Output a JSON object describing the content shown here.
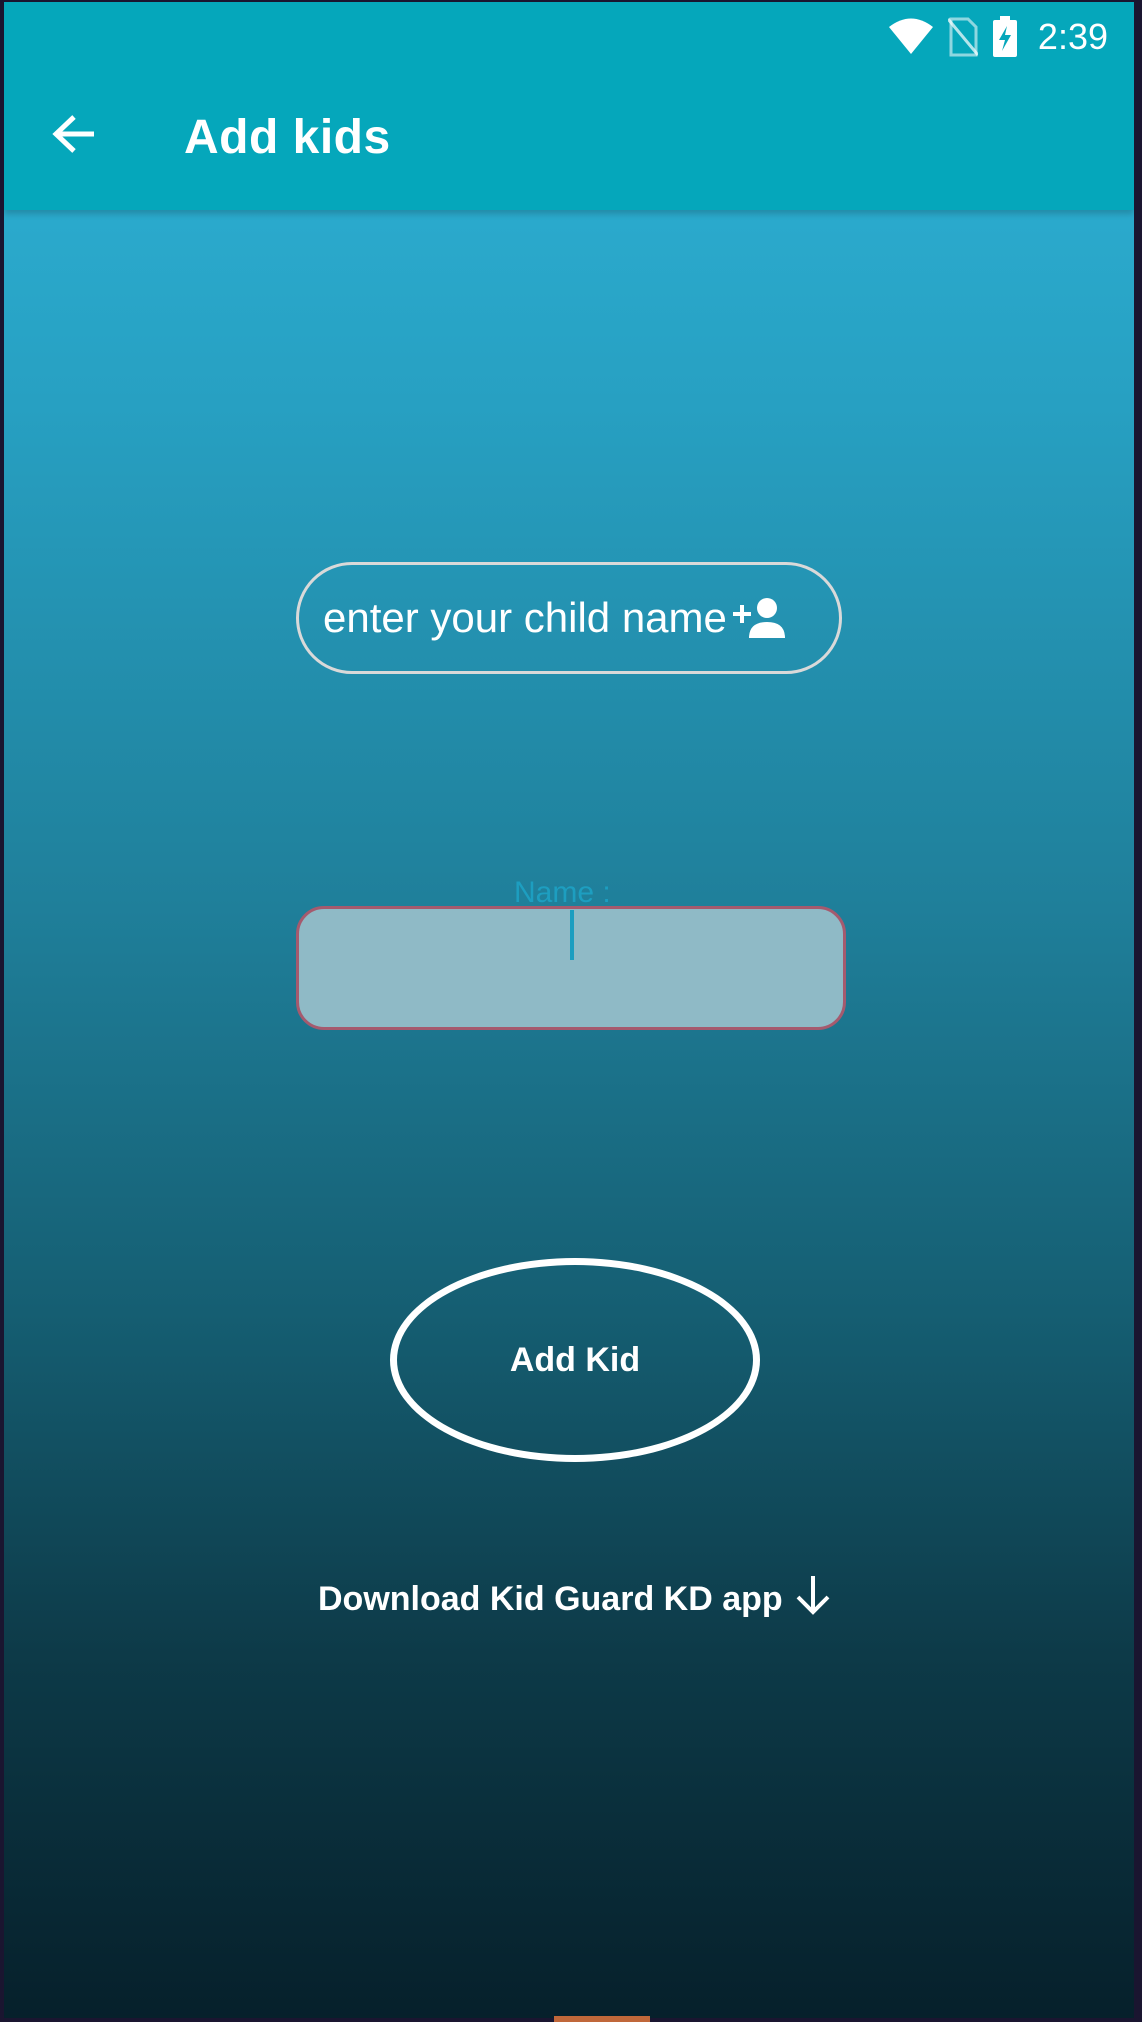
{
  "status_bar": {
    "time": "2:39",
    "icons": [
      "wifi-icon",
      "no-sim-icon",
      "battery-charging-icon"
    ]
  },
  "app_bar": {
    "back_icon": "arrow-left-icon",
    "title": "Add kids",
    "background": "#05a7bb"
  },
  "child_name_pill": {
    "text": "enter your child name",
    "icon": "add-person-icon"
  },
  "name_field": {
    "label": "Name :",
    "value": "",
    "background": "#8fbac6",
    "border": "#a55a6e"
  },
  "add_kid_button": {
    "label": "Add Kid"
  },
  "download_link": {
    "text": "Download Kid Guard KD app",
    "icon": "arrow-down-icon"
  },
  "colors": {
    "gradient_top": "#2eb4d8",
    "gradient_bottom": "#06202b",
    "accent": "#1d9ec0"
  }
}
